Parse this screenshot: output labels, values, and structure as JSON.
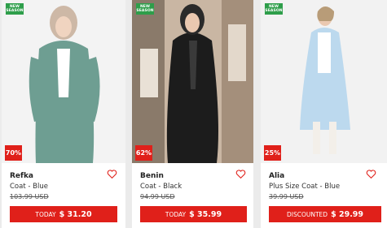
{
  "new_badge": {
    "line1": "NEW",
    "line2": "SEASON"
  },
  "products": [
    {
      "discount": "70%",
      "brand": "Refka",
      "name": "Coat - Blue",
      "old_price": "103.99 USD",
      "button_prefix": "TODAY",
      "price": "$ 31.20",
      "garment_color": "#6e9e92"
    },
    {
      "discount": "62%",
      "brand": "Benin",
      "name": "Coat - Black",
      "old_price": "94.99 USD",
      "button_prefix": "TODAY",
      "price": "$ 35.99",
      "garment_color": "#1c1c1c"
    },
    {
      "discount": "25%",
      "brand": "Alia",
      "name": "Plus Size Coat - Blue",
      "old_price": "39.99 USD",
      "button_prefix": "DISCOUNTED",
      "price": "$ 29.99",
      "garment_color": "#bcd9ee"
    }
  ],
  "colors": {
    "accent": "#e0201a",
    "new_badge": "#2e9e4a"
  },
  "icons": {
    "favorite": "heart-outline-icon"
  }
}
